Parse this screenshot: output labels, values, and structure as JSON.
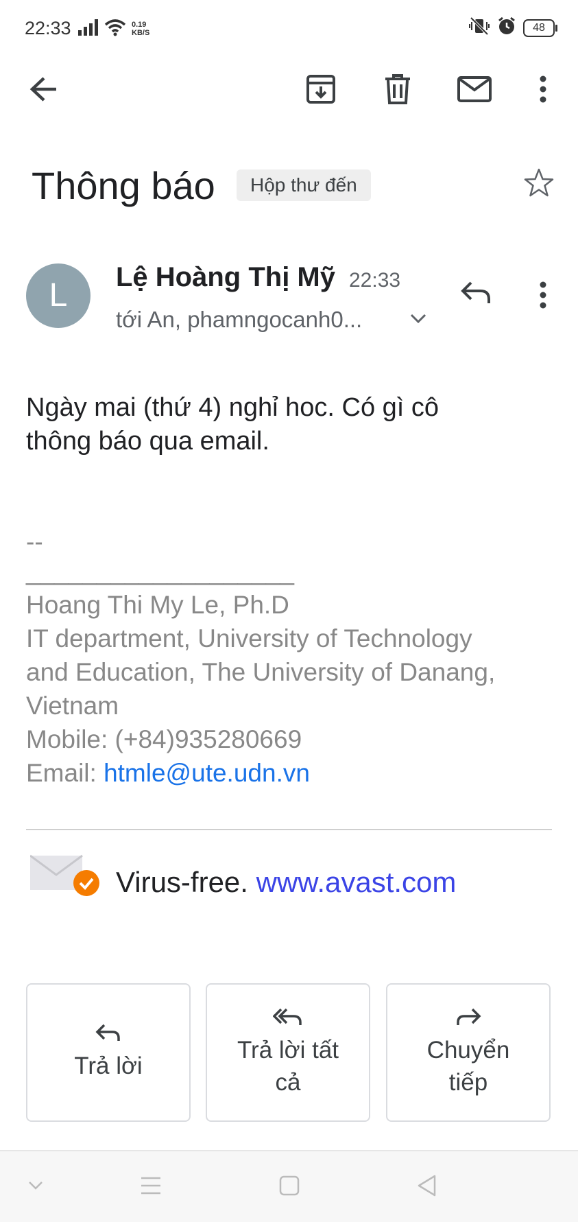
{
  "status_bar": {
    "time": "22:33",
    "net_speed_value": "0.19",
    "net_speed_unit": "KB/S",
    "battery": "48"
  },
  "toolbar": {
    "icons": [
      "back-arrow-icon",
      "archive-icon",
      "delete-icon",
      "mark-unread-icon",
      "more-vert-icon"
    ]
  },
  "email": {
    "subject": "Thông báo",
    "label": "Hộp thư đến",
    "sender_initial": "L",
    "sender_name": "Lệ Hoàng Thị Mỹ",
    "time": "22:33",
    "recipients": "tới An, phamngocanh0...",
    "body_line1": "Ngày mai (thứ 4) nghỉ hoc. Có gì cô",
    "body_line2": "thông báo qua email.",
    "signature": {
      "dashes": "--",
      "underline": "___________________",
      "name": "Hoang Thi My Le, Ph.D",
      "org_line1": "IT department, University of Technology",
      "org_line2": "and Education, The University of Danang,",
      "org_line3": "Vietnam",
      "mobile": "Mobile: (+84)935280669",
      "email_label": "Email: ",
      "email_link": "htmle@ute.udn.vn"
    },
    "virus_text": "Virus-free. ",
    "virus_link": "www.avast.com"
  },
  "actions": {
    "reply_label": "Trả lời",
    "reply_all_line1": "Trả lời tất",
    "reply_all_line2": "cả",
    "forward_line1": "Chuyển",
    "forward_line2": "tiếp"
  },
  "colors": {
    "link": "#1a73e8",
    "avast_link": "#3b44e6",
    "avatar": "#90a4ae",
    "signature_gray": "#888888",
    "check_orange": "#f57c00"
  }
}
